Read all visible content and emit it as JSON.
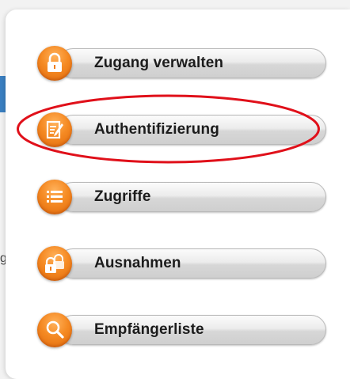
{
  "menu": {
    "items": [
      {
        "label": "Zugang verwalten",
        "icon": "lock-icon"
      },
      {
        "label": "Authentifizierung",
        "icon": "edit-document-icon",
        "highlighted": true
      },
      {
        "label": "Zugriffe",
        "icon": "list-icon"
      },
      {
        "label": "Ausnahmen",
        "icon": "locks-icon"
      },
      {
        "label": "Empfängerliste",
        "icon": "search-icon"
      }
    ]
  },
  "background": {
    "fragment_text": "g"
  },
  "colors": {
    "accent": "#f07d1a",
    "highlight": "#e0101a"
  }
}
